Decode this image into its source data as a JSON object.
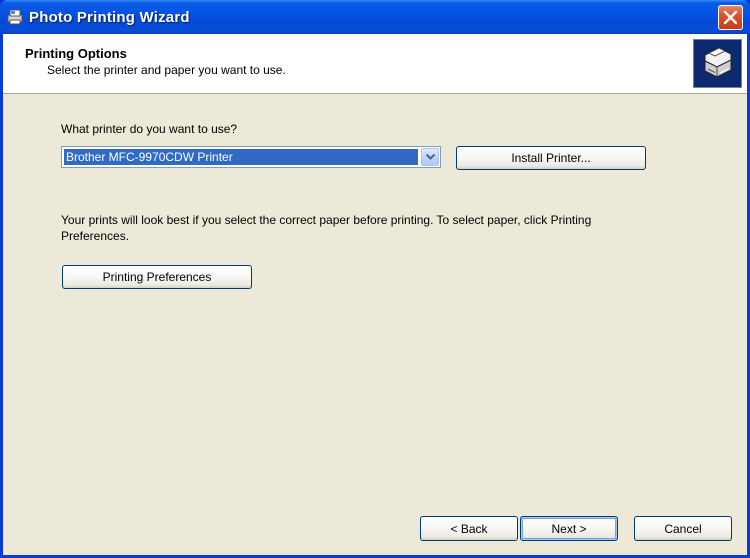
{
  "window": {
    "title": "Photo Printing Wizard",
    "colors": {
      "titlebar": "#0552e2",
      "client": "#ece9d8",
      "selection": "#316ac5"
    }
  },
  "header": {
    "title": "Printing Options",
    "subtitle": "Select the printer and paper you want to use.",
    "icon": "printer-icon"
  },
  "printer": {
    "label": "What printer do you want to use?",
    "selected": "Brother MFC-9970CDW Printer",
    "install_label": "Install Printer..."
  },
  "paper": {
    "info": "Your prints will look best if you select the correct paper before printing. To select paper, click Printing Preferences.",
    "preferences_label": "Printing Preferences"
  },
  "footer": {
    "back_label": "< Back",
    "next_label": "Next >",
    "cancel_label": "Cancel"
  }
}
